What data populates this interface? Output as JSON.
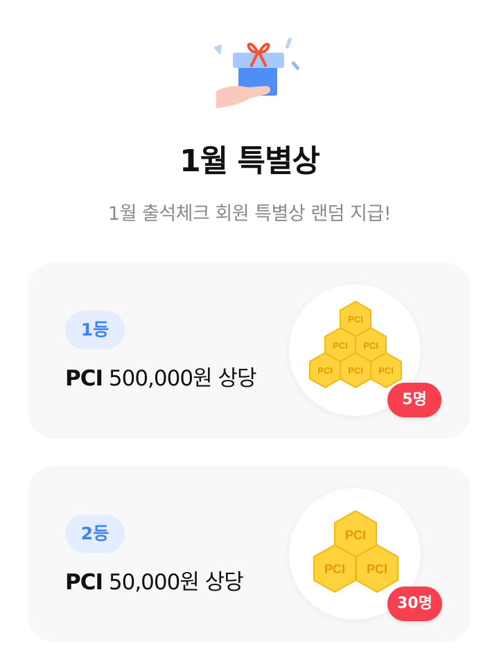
{
  "header": {
    "title": "1월 특별상",
    "subtitle": "1월 출석체크 회원 특별상 랜덤 지급!"
  },
  "icons": {
    "hero": "gift-in-hand-icon"
  },
  "colors": {
    "badge_bg": "#e3edfd",
    "badge_text": "#3f83f0",
    "count_badge": "#f6404f",
    "coin": "#fdd23c"
  },
  "prizes": [
    {
      "rank": "1등",
      "brand": "PCI",
      "amount": "500,000원 상당",
      "count": "5명",
      "coin_label": "PCI"
    },
    {
      "rank": "2등",
      "brand": "PCI",
      "amount": "50,000원 상당",
      "count": "30명",
      "coin_label": "PCI"
    }
  ]
}
